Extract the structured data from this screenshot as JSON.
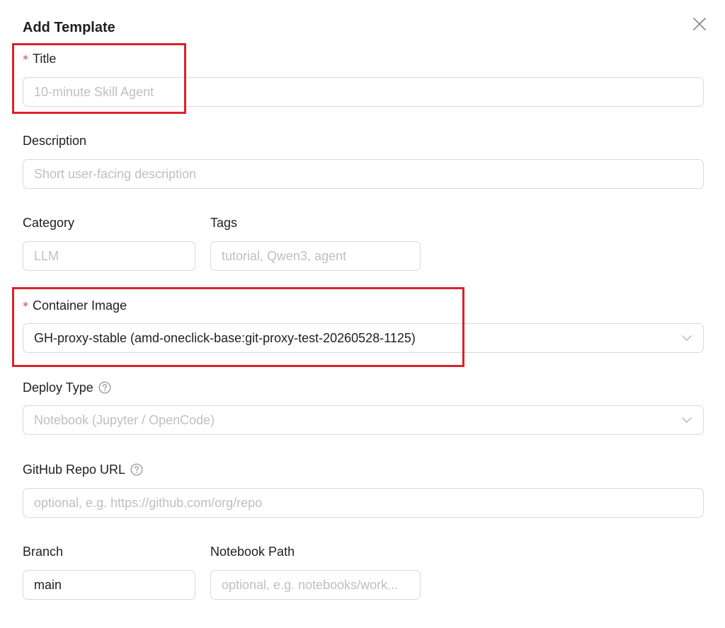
{
  "dialog": {
    "title": "Add Template"
  },
  "fields": {
    "title": {
      "label": "Title",
      "required_mark": "*",
      "placeholder": "10-minute Skill Agent",
      "value": ""
    },
    "description": {
      "label": "Description",
      "placeholder": "Short user-facing description",
      "value": ""
    },
    "category": {
      "label": "Category",
      "placeholder": "LLM",
      "value": ""
    },
    "tags": {
      "label": "Tags",
      "placeholder": "tutorial, Qwen3, agent",
      "value": ""
    },
    "container_image": {
      "label": "Container Image",
      "required_mark": "*",
      "value": "GH-proxy-stable (amd-oneclick-base:git-proxy-test-20260528-1125)"
    },
    "deploy_type": {
      "label": "Deploy Type",
      "placeholder": "Notebook (Jupyter / OpenCode)"
    },
    "github_repo_url": {
      "label": "GitHub Repo URL",
      "placeholder": "optional, e.g. https://github.com/org/repo",
      "value": ""
    },
    "branch": {
      "label": "Branch",
      "value": "main"
    },
    "notebook_path": {
      "label": "Notebook Path",
      "placeholder": "optional, e.g. notebooks/work...",
      "value": ""
    }
  },
  "icons": {
    "close": "close-icon",
    "help": "question-circle-icon",
    "chevron": "chevron-down-icon"
  },
  "colors": {
    "required": "#e53935",
    "highlight": "#d8232a",
    "border": "#d9d9d9",
    "placeholder": "#bfbfbf"
  }
}
